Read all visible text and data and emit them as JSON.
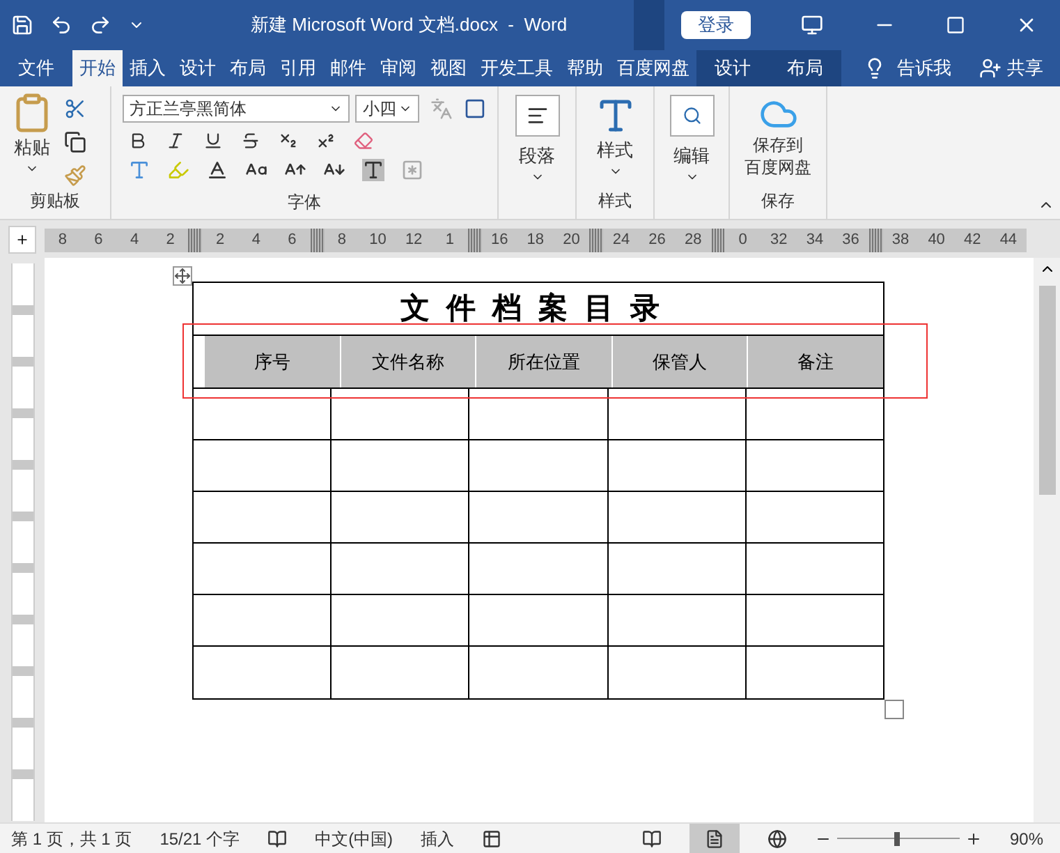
{
  "title_bar": {
    "title": "新建 Microsoft Word 文档.docx  -  Word",
    "login": "登录"
  },
  "menu_tabs": [
    {
      "label": "文件",
      "selected": false,
      "kind": "normal"
    },
    {
      "label": "开始",
      "selected": true,
      "kind": "normal"
    },
    {
      "label": "插入",
      "selected": false,
      "kind": "normal"
    },
    {
      "label": "设计",
      "selected": false,
      "kind": "normal"
    },
    {
      "label": "布局",
      "selected": false,
      "kind": "normal"
    },
    {
      "label": "引用",
      "selected": false,
      "kind": "normal"
    },
    {
      "label": "邮件",
      "selected": false,
      "kind": "normal"
    },
    {
      "label": "审阅",
      "selected": false,
      "kind": "normal"
    },
    {
      "label": "视图",
      "selected": false,
      "kind": "normal"
    },
    {
      "label": "开发工具",
      "selected": false,
      "kind": "normal"
    },
    {
      "label": "帮助",
      "selected": false,
      "kind": "normal"
    },
    {
      "label": "百度网盘",
      "selected": false,
      "kind": "normal"
    },
    {
      "label": "设计",
      "selected": false,
      "kind": "contextual"
    },
    {
      "label": "布局",
      "selected": false,
      "kind": "contextual"
    }
  ],
  "tell_me": "告诉我",
  "share": "共享",
  "ribbon": {
    "clipboard": {
      "paste": "粘贴",
      "group": "剪贴板"
    },
    "font": {
      "font_name": "方正兰亭黑简体",
      "font_size": "小四",
      "group": "字体"
    },
    "paragraph": {
      "label": "段落"
    },
    "styles": {
      "label": "样式",
      "group": "样式"
    },
    "editing": {
      "label": "编辑"
    },
    "save": {
      "label_line1": "保存到",
      "label_line2": "百度网盘",
      "group": "保存"
    }
  },
  "ruler": [
    {
      "kind": "num",
      "text": "8"
    },
    {
      "kind": "num",
      "text": "6"
    },
    {
      "kind": "num",
      "text": "4"
    },
    {
      "kind": "num",
      "text": "2"
    },
    {
      "kind": "marker"
    },
    {
      "kind": "num",
      "text": "2"
    },
    {
      "kind": "num",
      "text": "4"
    },
    {
      "kind": "num",
      "text": "6"
    },
    {
      "kind": "marker"
    },
    {
      "kind": "num",
      "text": "8"
    },
    {
      "kind": "num",
      "text": "10"
    },
    {
      "kind": "num",
      "text": "12"
    },
    {
      "kind": "num",
      "text": "1"
    },
    {
      "kind": "marker"
    },
    {
      "kind": "num",
      "text": "16"
    },
    {
      "kind": "num",
      "text": "18"
    },
    {
      "kind": "num",
      "text": "20"
    },
    {
      "kind": "marker"
    },
    {
      "kind": "num",
      "text": "24"
    },
    {
      "kind": "num",
      "text": "26"
    },
    {
      "kind": "num",
      "text": "28"
    },
    {
      "kind": "marker"
    },
    {
      "kind": "num",
      "text": "0"
    },
    {
      "kind": "num",
      "text": "32"
    },
    {
      "kind": "num",
      "text": "34"
    },
    {
      "kind": "num",
      "text": "36"
    },
    {
      "kind": "marker"
    },
    {
      "kind": "num",
      "text": "38"
    },
    {
      "kind": "num",
      "text": "40"
    },
    {
      "kind": "num",
      "text": "42"
    },
    {
      "kind": "num",
      "text": "44"
    }
  ],
  "table": {
    "title": "文件档案目录",
    "columns": [
      "序号",
      "文件名称",
      "所在位置",
      "保管人",
      "备注"
    ]
  },
  "status_bar": {
    "page": "第 1 页，共 1 页",
    "words": "15/21 个字",
    "language": "中文(中国)",
    "mode": "插入",
    "zoom": "90%",
    "zoom_slider": {
      "level": 0.47
    }
  }
}
